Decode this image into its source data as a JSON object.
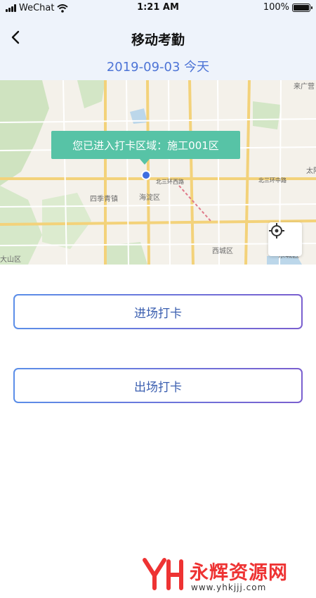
{
  "status_bar": {
    "carrier": "WeChat",
    "time": "1:21 AM",
    "battery": "100%"
  },
  "header": {
    "title": "移动考勤",
    "date": "2019-09-03",
    "day_label": "今天"
  },
  "map": {
    "region_message": "您已进入打卡区域：施工001区",
    "labels": {
      "haidian": "海淀区",
      "sijiqing": "四季青镇",
      "xicheng": "西城区",
      "dongcheng": "东城区",
      "laiguang": "来广营",
      "tai": "太阳",
      "beisanhuan": "北三环西路",
      "beisanhuan_zhong": "北三环中路",
      "shanqu": "大山区"
    }
  },
  "actions": {
    "check_in": "进场打卡",
    "check_out": "出场打卡"
  },
  "watermark": {
    "text": "永辉资源网",
    "url": "www.yhkjjj.com"
  },
  "colors": {
    "header_bg": "#eef3fb",
    "accent_blue": "#4d74d6",
    "tooltip_green": "#57c3a6",
    "watermark_red": "#e33333"
  }
}
